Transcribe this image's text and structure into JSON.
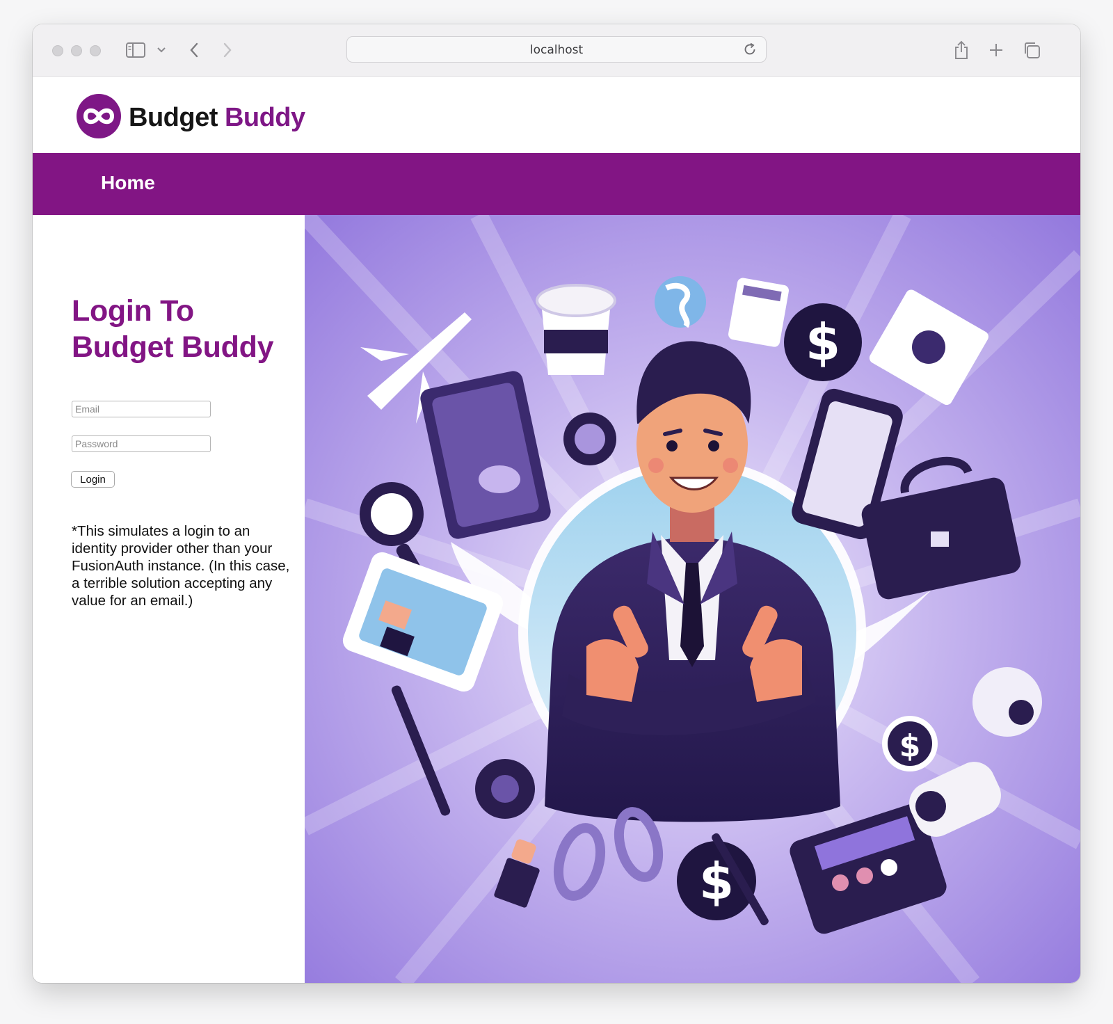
{
  "browser": {
    "address": "localhost",
    "traffic_lights": [
      "close",
      "minimize",
      "zoom"
    ],
    "toolbar_icons": [
      "sidebar-icon",
      "chevron-down-icon",
      "back-arrow-icon",
      "forward-arrow-icon",
      "reload-icon",
      "share-icon",
      "new-tab-icon",
      "tabs-overview-icon"
    ]
  },
  "site": {
    "brand_part1": "Budget",
    "brand_part2": "Buddy",
    "brand_color": "#7e1786",
    "nav_color": "#821584",
    "nav": {
      "home": "Home"
    }
  },
  "login": {
    "title": "Login To Budget Buddy",
    "email_placeholder": "Email",
    "password_placeholder": "Password",
    "button": "Login",
    "note": "*This simulates a login to an identity provider other than your FusionAuth instance. (In this case, a terrible solution accepting any value for an email.)"
  },
  "hero": {
    "alt": "Illustration of a smiling businessman with arms crossed giving thumbs up, surrounded by finance items: dollar coins, calculator, briefcase, phone, coffee cup, airplane, globe, pens and scissors on a purple background"
  }
}
